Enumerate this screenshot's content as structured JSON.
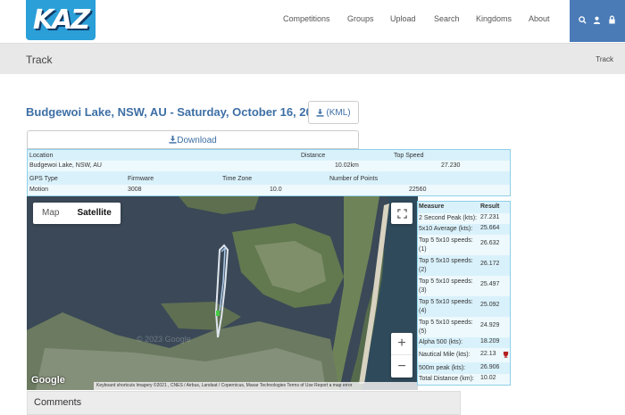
{
  "nav": {
    "logo_text": "KAZ",
    "links": [
      "Competitions",
      "Groups",
      "Upload",
      "Search",
      "Kingdoms",
      "About"
    ]
  },
  "banner": {
    "title": "Track",
    "crumb": "Track"
  },
  "track": {
    "title": "Budgewoi Lake, NSW, AU - Saturday, October 16, 2021",
    "kml_label": "(KML)",
    "download_label": "Download"
  },
  "info": {
    "headers1": {
      "location": "Location",
      "distance": "Distance",
      "top_speed": "Top Speed"
    },
    "values1": {
      "location": "Budgewoi Lake, NSW, AU",
      "distance": "10.02km",
      "top_speed": "27.230"
    },
    "headers2": {
      "gps_type": "GPS Type",
      "firmware": "Firmware",
      "time_zone": "Time Zone",
      "points": "Number of Points"
    },
    "values2": {
      "gps_type": "Motion",
      "firmware": "3008",
      "time_zone": "10.0",
      "points": "22560"
    }
  },
  "map": {
    "map_label": "Map",
    "satellite_label": "Satellite",
    "google": "Google",
    "watermark": "© 2023 Google",
    "attribution": "Keyboard shortcuts   Imagery ©2021 , CNES / Airbus, Landsat / Copernicus, Maxar Technologies   Terms of Use   Report a map error"
  },
  "results": {
    "header_measure": "Measure",
    "header_result": "Result",
    "rows": [
      {
        "measure": "2 Second Peak (kts):",
        "result": "27.231"
      },
      {
        "measure": "5x10 Average (kts):",
        "result": "25.664"
      },
      {
        "measure": "Top 5 5x10 speeds: (1)",
        "result": "26.632"
      },
      {
        "measure": "Top 5 5x10 speeds: (2)",
        "result": "26.172"
      },
      {
        "measure": "Top 5 5x10 speeds: (3)",
        "result": "25.497"
      },
      {
        "measure": "Top 5 5x10 speeds: (4)",
        "result": "25.092"
      },
      {
        "measure": "Top 5 5x10 speeds: (5)",
        "result": "24.929"
      },
      {
        "measure": "Alpha 500 (kts):",
        "result": "18.209"
      },
      {
        "measure": "Nautical Mile (kts):",
        "result": "22.13"
      },
      {
        "measure": "500m peak (kts):",
        "result": "26.906"
      },
      {
        "measure": "Total Distance (km):",
        "result": "10.02"
      }
    ]
  },
  "comments": {
    "label": "Comments"
  }
}
